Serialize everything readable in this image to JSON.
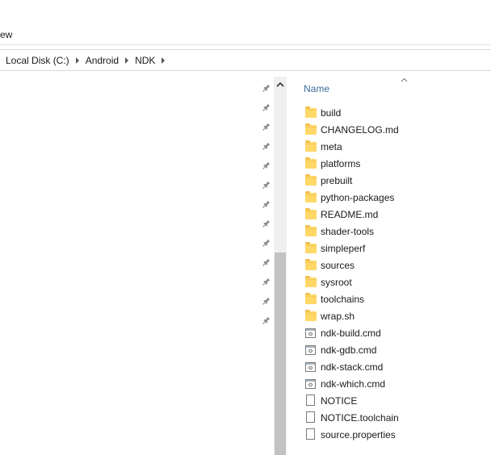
{
  "ribbon": {
    "tab_view_partial": "ew"
  },
  "breadcrumb": {
    "items": [
      "Local Disk (C:)",
      "Android",
      "NDK"
    ]
  },
  "file_list": {
    "column_header": "Name",
    "sort": "ascending",
    "items": [
      {
        "name": "build",
        "icon": "folder-icon"
      },
      {
        "name": "CHANGELOG.md",
        "icon": "folder-icon"
      },
      {
        "name": "meta",
        "icon": "folder-icon"
      },
      {
        "name": "platforms",
        "icon": "folder-icon"
      },
      {
        "name": "prebuilt",
        "icon": "folder-icon"
      },
      {
        "name": "python-packages",
        "icon": "folder-icon"
      },
      {
        "name": "README.md",
        "icon": "folder-icon"
      },
      {
        "name": "shader-tools",
        "icon": "folder-icon"
      },
      {
        "name": "simpleperf",
        "icon": "folder-icon"
      },
      {
        "name": "sources",
        "icon": "folder-icon"
      },
      {
        "name": "sysroot",
        "icon": "folder-icon"
      },
      {
        "name": "toolchains",
        "icon": "folder-icon"
      },
      {
        "name": "wrap.sh",
        "icon": "folder-icon"
      },
      {
        "name": "ndk-build.cmd",
        "icon": "cmd-file-icon"
      },
      {
        "name": "ndk-gdb.cmd",
        "icon": "cmd-file-icon"
      },
      {
        "name": "ndk-stack.cmd",
        "icon": "cmd-file-icon"
      },
      {
        "name": "ndk-which.cmd",
        "icon": "cmd-file-icon"
      },
      {
        "name": "NOTICE",
        "icon": "file-icon"
      },
      {
        "name": "NOTICE.toolchain",
        "icon": "file-icon"
      },
      {
        "name": "source.properties",
        "icon": "file-icon"
      }
    ]
  },
  "nav_pane": {
    "pinned_count": 13,
    "pin_icon": "pin-icon"
  },
  "colors": {
    "header_text": "#3d6d9c",
    "folder": "#ffd868",
    "scroll_thumb": "#c2c2c2"
  }
}
